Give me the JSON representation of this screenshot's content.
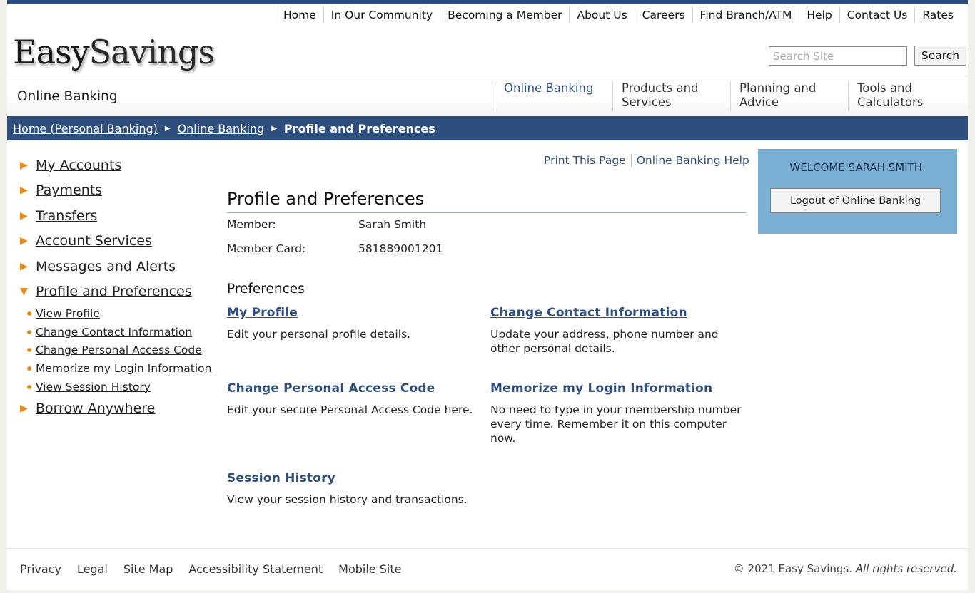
{
  "utility_nav": [
    "Home",
    "In Our Community",
    "Becoming a Member",
    "About Us",
    "Careers",
    "Find Branch/ATM",
    "Help",
    "Contact Us",
    "Rates"
  ],
  "logo": {
    "part1": "Easy",
    "part2": "Savings"
  },
  "search": {
    "placeholder": "Search Site",
    "button": "Search"
  },
  "section_title": "Online Banking",
  "main_nav": [
    {
      "line1": "Online Banking",
      "line2": "",
      "active": true
    },
    {
      "line1": "Products and",
      "line2": "Services",
      "active": false
    },
    {
      "line1": "Planning and",
      "line2": "Advice",
      "active": false
    },
    {
      "line1": "Tools and",
      "line2": "Calculators",
      "active": false
    }
  ],
  "breadcrumb": {
    "home": "Home (Personal Banking)",
    "online": "Online Banking",
    "current": "Profile and Preferences",
    "sep": "▶"
  },
  "left_nav": {
    "items": [
      "My Accounts",
      "Payments",
      "Transfers",
      "Account Services",
      "Messages and Alerts",
      "Profile and Preferences"
    ],
    "subitems": [
      "View Profile",
      "Change Contact Information",
      "Change Personal Access Code",
      "Memorize my Login Information",
      "View Session History"
    ],
    "last": "Borrow Anywhere",
    "arrow": "▶",
    "arrow_open": "▼"
  },
  "util_links": {
    "print": "Print This Page",
    "help": "Online Banking Help"
  },
  "page_title": "Profile and Preferences",
  "member": {
    "label": "Member:",
    "value": "Sarah Smith"
  },
  "member_card": {
    "label": "Member Card:",
    "value": "581889001201"
  },
  "preferences_heading": "Preferences",
  "preferences": [
    {
      "title": "My Profile",
      "desc": "Edit your personal profile details."
    },
    {
      "title": "Change Contact Information",
      "desc": "Update your address, phone number and other personal details."
    },
    {
      "title": "Change Personal Access Code",
      "desc": "Edit your secure Personal Access Code here."
    },
    {
      "title": "Memorize my Login Information",
      "desc": "No need to type in your membership number every time. Remember it on this computer now."
    },
    {
      "title": "Session History",
      "desc": "View your session history and transactions."
    }
  ],
  "welcome": {
    "text": "WELCOME SARAH SMITH.",
    "logout": "Logout of Online Banking"
  },
  "footer": {
    "links": [
      "Privacy",
      "Legal",
      "Site Map",
      "Accessibility Statement",
      "Mobile Site"
    ],
    "copyright": "© 2021 Easy Savings.",
    "rights": "All rights reserved."
  },
  "colors": {
    "brand": "#2e4e7e",
    "accent": "#e88a1a",
    "welcome_bg": "#7aaed2"
  }
}
